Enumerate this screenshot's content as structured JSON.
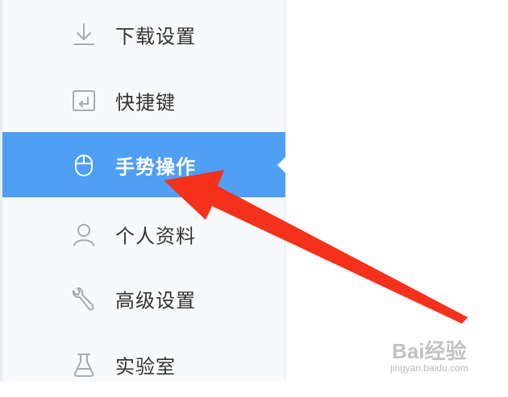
{
  "sidebar": {
    "items": [
      {
        "label": "下载设置",
        "icon": "download-icon",
        "active": false
      },
      {
        "label": "快捷键",
        "icon": "keyboard-shortcut-icon",
        "active": false
      },
      {
        "label": "手势操作",
        "icon": "mouse-icon",
        "active": true
      },
      {
        "label": "个人资料",
        "icon": "user-icon",
        "active": false
      },
      {
        "label": "高级设置",
        "icon": "wrench-icon",
        "active": false
      },
      {
        "label": "实验室",
        "icon": "flask-icon",
        "active": false
      }
    ]
  },
  "colors": {
    "active_bg": "#4f9ff5",
    "sidebar_bg": "#f7f9fb",
    "icon_gray": "#a6abb2",
    "arrow_red": "#f5311c"
  },
  "watermark": {
    "main": "Bai经验",
    "sub": "jingyan.baidu.com"
  }
}
